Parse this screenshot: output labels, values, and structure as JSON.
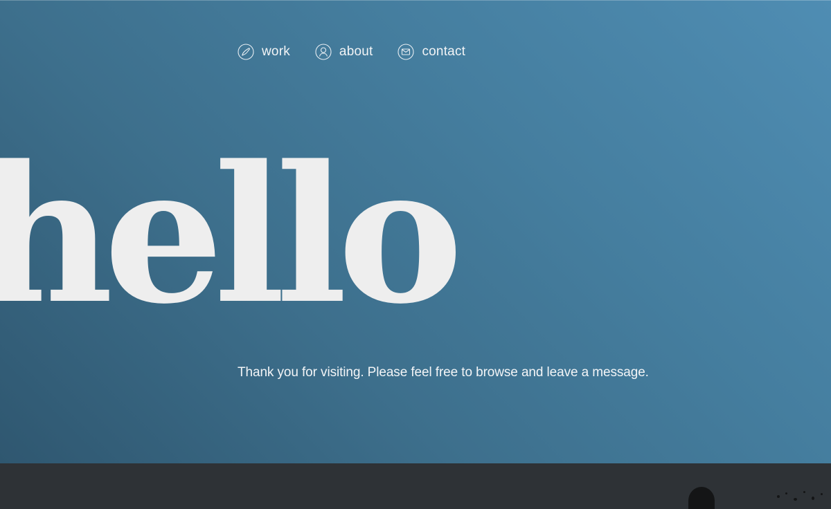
{
  "nav": {
    "items": [
      {
        "label": "work",
        "icon": "brush-icon"
      },
      {
        "label": "about",
        "icon": "person-icon"
      },
      {
        "label": "contact",
        "icon": "envelope-icon"
      }
    ]
  },
  "hero": {
    "headline": "hello",
    "tagline": "Thank you for visiting. Please feel free to browse and leave a message."
  },
  "colors": {
    "hero_gradient_light": "#4f8db3",
    "hero_gradient_dark": "#2f5770",
    "headline": "#eeeeee",
    "footer": "#2e3236"
  }
}
